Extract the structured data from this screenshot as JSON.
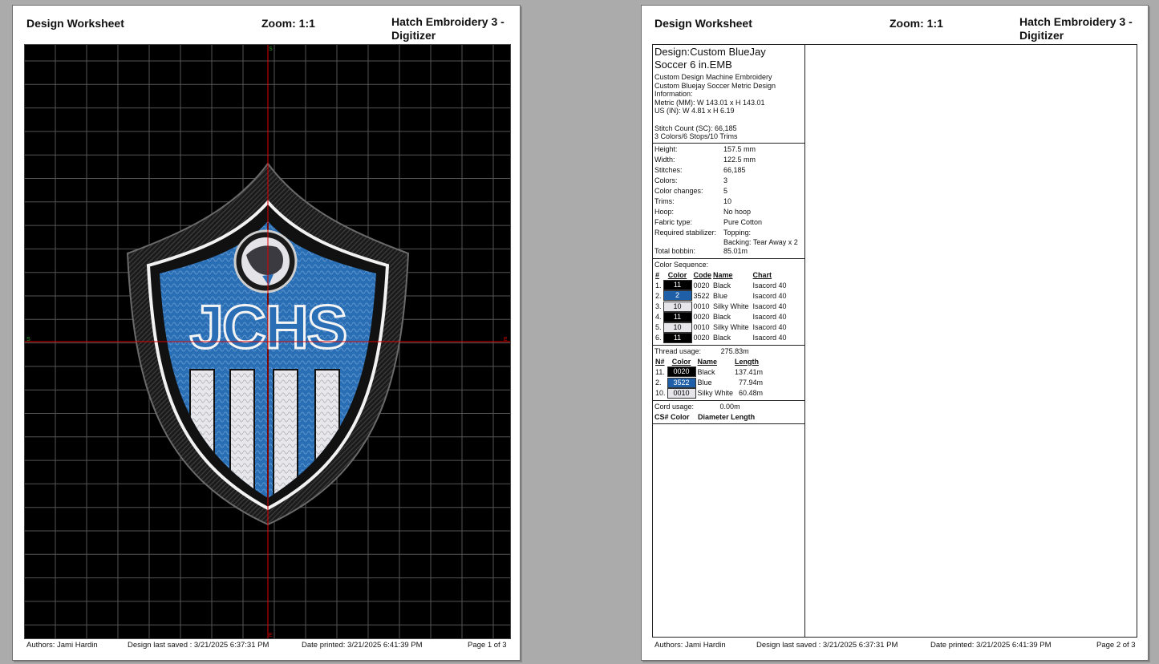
{
  "header": {
    "title": "Design Worksheet",
    "zoom": "Zoom:  1:1",
    "app_line1": "Hatch Embroidery 3 -",
    "app_line2": "Digitizer"
  },
  "page1": {
    "design_text": "JCHS",
    "axis_labels": {
      "top": "S",
      "left": "S",
      "right": "E",
      "bottom": "E"
    },
    "footer": {
      "authors": "Authors: Jami Hardin",
      "saved": "Design last saved : 3/21/2025 6:37:31 PM",
      "printed": "Date printed: 3/21/2025 6:41:39 PM",
      "page": "Page 1 of 3"
    }
  },
  "page2": {
    "design_name_line1": "Design:Custom BlueJay",
    "design_name_line2": "Soccer 6 in.EMB",
    "info_lines": [
      "Custom Design Machine Embroidery",
      "Custom Bluejay Soccer Metric Design",
      "Information:",
      "Metric (MM): W 143.01 x H 143.01",
      "US (IN): W 4.81 x H 6.19",
      "",
      "Stitch Count (SC): 66,185",
      "3 Colors/6 Stops/10 Trims"
    ],
    "properties": [
      {
        "key": "Height:",
        "value": "157.5 mm"
      },
      {
        "key": "Width:",
        "value": "122.5 mm"
      },
      {
        "key": "Stitches:",
        "value": "66,185"
      },
      {
        "key": "Colors:",
        "value": "3"
      },
      {
        "key": "Color changes:",
        "value": "5"
      },
      {
        "key": "Trims:",
        "value": "10"
      },
      {
        "key": "Hoop:",
        "value": "No hoop"
      },
      {
        "key": "Fabric type:",
        "value": "Pure Cotton"
      },
      {
        "key": "Required stabilizer:",
        "value": "Topping:"
      },
      {
        "key": "",
        "value": "Backing: Tear Away x 2"
      },
      {
        "key": "Total bobbin:",
        "value": "85.01m"
      }
    ],
    "color_sequence": {
      "title": "Color Sequence:",
      "headers": [
        "#",
        "Color",
        "Code",
        "Name",
        "Chart"
      ],
      "rows": [
        {
          "num": "1.",
          "swatch": "11",
          "bg": "#000000",
          "fg": "#ffffff",
          "code": "0020",
          "name": "Black",
          "chart": "Isacord 40"
        },
        {
          "num": "2.",
          "swatch": "2",
          "bg": "#1f5fa8",
          "fg": "#ffffff",
          "code": "3522",
          "name": "Blue",
          "chart": "Isacord 40"
        },
        {
          "num": "3.",
          "swatch": "10",
          "bg": "#e6e6ea",
          "fg": "#000000",
          "code": "0010",
          "name": "Silky White",
          "chart": "Isacord 40"
        },
        {
          "num": "4.",
          "swatch": "11",
          "bg": "#000000",
          "fg": "#ffffff",
          "code": "0020",
          "name": "Black",
          "chart": "Isacord 40"
        },
        {
          "num": "5.",
          "swatch": "10",
          "bg": "#e6e6ea",
          "fg": "#000000",
          "code": "0010",
          "name": "Silky White",
          "chart": "Isacord 40"
        },
        {
          "num": "6.",
          "swatch": "11",
          "bg": "#000000",
          "fg": "#ffffff",
          "code": "0020",
          "name": "Black",
          "chart": "Isacord 40"
        }
      ]
    },
    "thread_usage": {
      "label": "Thread usage:",
      "total": "275.83m",
      "headers": [
        "N#",
        "Color",
        "Name",
        "Length"
      ],
      "rows": [
        {
          "num": "11.",
          "swatch": "0020",
          "bg": "#000000",
          "fg": "#ffffff",
          "name": "Black",
          "length": "137.41m"
        },
        {
          "num": "2.",
          "swatch": "3522",
          "bg": "#1f5fa8",
          "fg": "#ffffff",
          "name": "Blue",
          "length": "77.94m"
        },
        {
          "num": "10.",
          "swatch": "0010",
          "bg": "#e6e6ea",
          "fg": "#000000",
          "name": "Silky White",
          "length": "60.48m"
        }
      ]
    },
    "cord_usage": {
      "label": "Cord usage:",
      "total": "0.00m",
      "headers": [
        "CS#",
        "Color",
        "Diameter",
        "Length"
      ]
    },
    "footer": {
      "authors": "Authors: Jami Hardin",
      "saved": "Design last saved : 3/21/2025 6:37:31 PM",
      "printed": "Date printed: 3/21/2025 6:41:39 PM",
      "page": "Page 2 of 3"
    }
  },
  "colors": {
    "background": "#ababab",
    "canvas": "#000000",
    "grid": "#555555",
    "crosshair": "#e00000",
    "shield_blue": "#2a6fb5",
    "shield_white": "#e8e8ec"
  }
}
